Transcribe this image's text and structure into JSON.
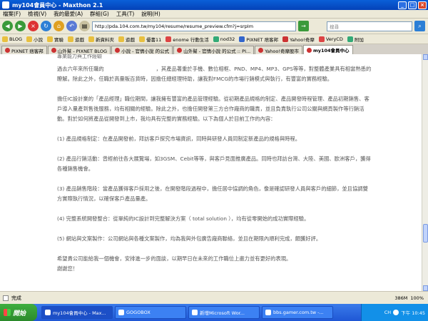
{
  "window": {
    "title": "my104會員中心 - Maxthon 2.1"
  },
  "menu": [
    "檔案(F)",
    "檢視(V)",
    "我的最愛(A)",
    "群組(G)",
    "工具(T)",
    "說明(H)"
  ],
  "address": {
    "value": "http://pda.104.com.tw/my104/resume/resume_preview.cfm?j=srpIm"
  },
  "search": {
    "placeholder": "搜尋"
  },
  "favorites": [
    "BLOG",
    "小說",
    "實驗",
    "遊戲",
    "新資料夾",
    "遊戲",
    "優書11",
    "enome 行動生活",
    "nod32",
    "PIXNET 痞客邦",
    "Yahoo!奇摩",
    "VeryCD",
    "附加"
  ],
  "tabs": [
    {
      "label": "PIXNET 痞客邦",
      "active": false
    },
    {
      "label": "山外幫 - PIXNET BLOG",
      "active": false
    },
    {
      "label": "小說 - 官情小說 的公式",
      "active": false
    },
    {
      "label": "山外幫 - 官情小說 的公式 :: PI...",
      "active": false
    },
    {
      "label": "Yahoo!奇摩股市",
      "active": false
    },
    {
      "label": "my104會員中心",
      "active": true
    }
  ],
  "content": {
    "top_cut": "專業能力與工作經驗",
    "paragraphs": [
      "過去六年來所任職的　　　　　　　　　　，其產品著重於手機、數位相框、PND、MP4、MP3、GPS等等，對整體產業具有相當熟悉的瞭解。除此之外，任職於高量販百貨時，因擔任總經理特助，讓我對FMCG的市場行銷模式與執行，有豐富的實務經驗。",
      "擔任IC設計業的「產品經理」職位期間，讓我擁有豐富的產品管理經驗。從初期產品規格的制定、產品開發時程管理、產品初期銷售、客戶導入量產到售後服務，均有相關的經驗。除此之外，也擔任開發第三方合作廠商的職責，並且負責執行公司公關與網頁製作等行銷活動。對於如何將產品從開發到上市，我均具有完整的實務經驗。以下為個人於目前工作的內容：",
      "(1) 產品規格制定：在產品開發前，拜訪客戶探究市場資訊，同時與研發人員同制定新產品的規格與時程。",
      "(2) 產品行銷活動：曾經前往各大展覽場，如3GSM、Cebit等等，與客戶見面推廣產品。同時也拜訪台灣、大陸、美國、歐洲客戶，獲得各種銷售機會。",
      "(3) 產品銷售階段：當產品獲得客戶採用之後，在開發階段過程中，擔任居中協調的角色，像是確認研發人員與客戶的細節，並且協調雙方實際執行情況，以確保客戶產品量產。",
      "(4) 完整系統開發整合：從單純的IC設計到完整解決方案（ total solution ），均有從零開始的成功實際經驗。",
      "(5) 網站與文案製作：公司網站與各種文案製作，均為我與外包廣告廠商聯絡，並且在期限內順利完成，頗獲好評。",
      "希望貴公司能給我一個機會，安排進一步的面談，以期早日在未來的工作職位上盡力並有更好的表現。\n謝謝您！"
    ]
  },
  "status": {
    "text": "完成",
    "memory": "386M",
    "zoom": "100%"
  },
  "taskbar": {
    "start": "開始",
    "tasks": [
      "my104會員中心 - Max...",
      "GOGOBOX",
      "新增Microsoft Wor...",
      "bbs.gamer.com.tw -..."
    ],
    "lang": "CH",
    "clock": "下午 10:45"
  }
}
